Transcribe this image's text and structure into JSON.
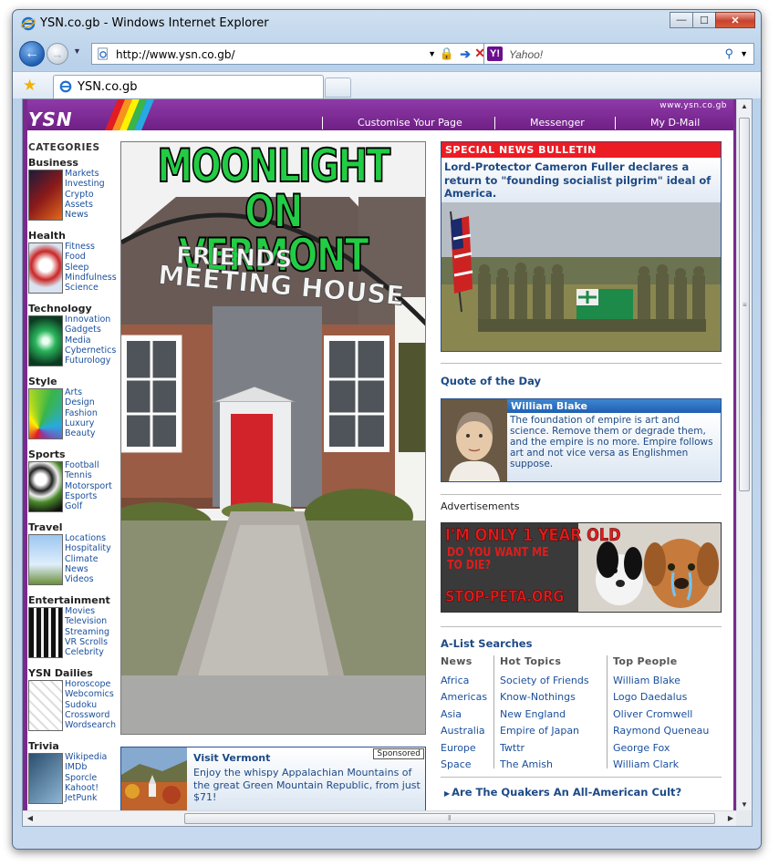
{
  "window": {
    "title": "YSN.co.gb - Windows Internet Explorer",
    "controls": {
      "minimize": "—",
      "maximize": "☐",
      "close": "✕"
    }
  },
  "address_bar": {
    "url": "http://www.ysn.co.gb/"
  },
  "search_bar": {
    "logo": "Y!",
    "placeholder": "Yahoo!"
  },
  "tab": {
    "label": "YSN.co.gb"
  },
  "header": {
    "logo": "YSN",
    "site_url": "www.ysn.co.gb",
    "nav": [
      "Customise Your Page",
      "Messenger",
      "My D-Mail"
    ]
  },
  "categories": {
    "title": "CATEGORIES",
    "groups": [
      {
        "name": "Business",
        "links": [
          "Markets",
          "Investing",
          "Crypto",
          "Assets",
          "News"
        ]
      },
      {
        "name": "Health",
        "links": [
          "Fitness",
          "Food",
          "Sleep",
          "Mindfulness",
          "Science"
        ]
      },
      {
        "name": "Technology",
        "links": [
          "Innovation",
          "Gadgets",
          "Media",
          "Cybernetics",
          "Futurology"
        ]
      },
      {
        "name": "Style",
        "links": [
          "Arts",
          "Design",
          "Fashion",
          "Luxury",
          "Beauty"
        ]
      },
      {
        "name": "Sports",
        "links": [
          "Football",
          "Tennis",
          "Motorsport",
          "Esports",
          "Golf"
        ]
      },
      {
        "name": "Travel",
        "links": [
          "Locations",
          "Hospitality",
          "Climate",
          "News",
          "Videos"
        ]
      },
      {
        "name": "Entertainment",
        "links": [
          "Movies",
          "Television",
          "Streaming",
          "VR Scrolls",
          "Celebrity"
        ]
      },
      {
        "name": "YSN Dailies",
        "links": [
          "Horoscope",
          "Webcomics",
          "Sudoku",
          "Crossword",
          "Wordsearch"
        ]
      },
      {
        "name": "Trivia",
        "links": [
          "Wikipedia",
          "IMDb",
          "Sporcle",
          "Kahoot!",
          "JetPunk"
        ]
      }
    ]
  },
  "feature": {
    "title_line1": "MOONLIGHT",
    "title_line2": "ON VERMONT",
    "sign_line1": "FRIENDS",
    "sign_line2": "MEETING HOUSE"
  },
  "sponsored": {
    "badge": "Sponsored",
    "title": "Visit Vermont",
    "body": "Enjoy the whispy Appalachian Mountains of the great Green Mountain Republic, from just $71!"
  },
  "bulletin": {
    "bar": "SPECIAL NEWS BULLETIN",
    "headline": "Lord-Protector Cameron Fuller declares a return to \"founding socialist pilgrim\" ideal of America."
  },
  "quote": {
    "section_title": "Quote of the Day",
    "author": "William Blake",
    "text": "The foundation of empire is art and science. Remove them or degrade them, and the empire is no more. Empire follows art and not vice versa as Englishmen suppose."
  },
  "ads": {
    "label": "Advertisements",
    "line1": "I'M ONLY 1 YEAR OLD",
    "line2a": "DO YOU WANT ME",
    "line2b": "TO DIE?",
    "line3": "STOP-PETA.ORG"
  },
  "alist": {
    "title": "A-List Searches",
    "columns": [
      {
        "header": "News",
        "items": [
          "Africa",
          "Americas",
          "Asia",
          "Australia",
          "Europe",
          "Space"
        ]
      },
      {
        "header": "Hot Topics",
        "items": [
          "Society of Friends",
          "Know-Nothings",
          "New England",
          "Empire of Japan",
          "Twttr",
          "The Amish"
        ]
      },
      {
        "header": "Top People",
        "items": [
          "William Blake",
          "Logo Daedalus",
          "Oliver Cromwell",
          "Raymond Queneau",
          "George Fox",
          "William Clark"
        ]
      }
    ],
    "footer_link": "Are The Quakers An All-American Cult?"
  }
}
